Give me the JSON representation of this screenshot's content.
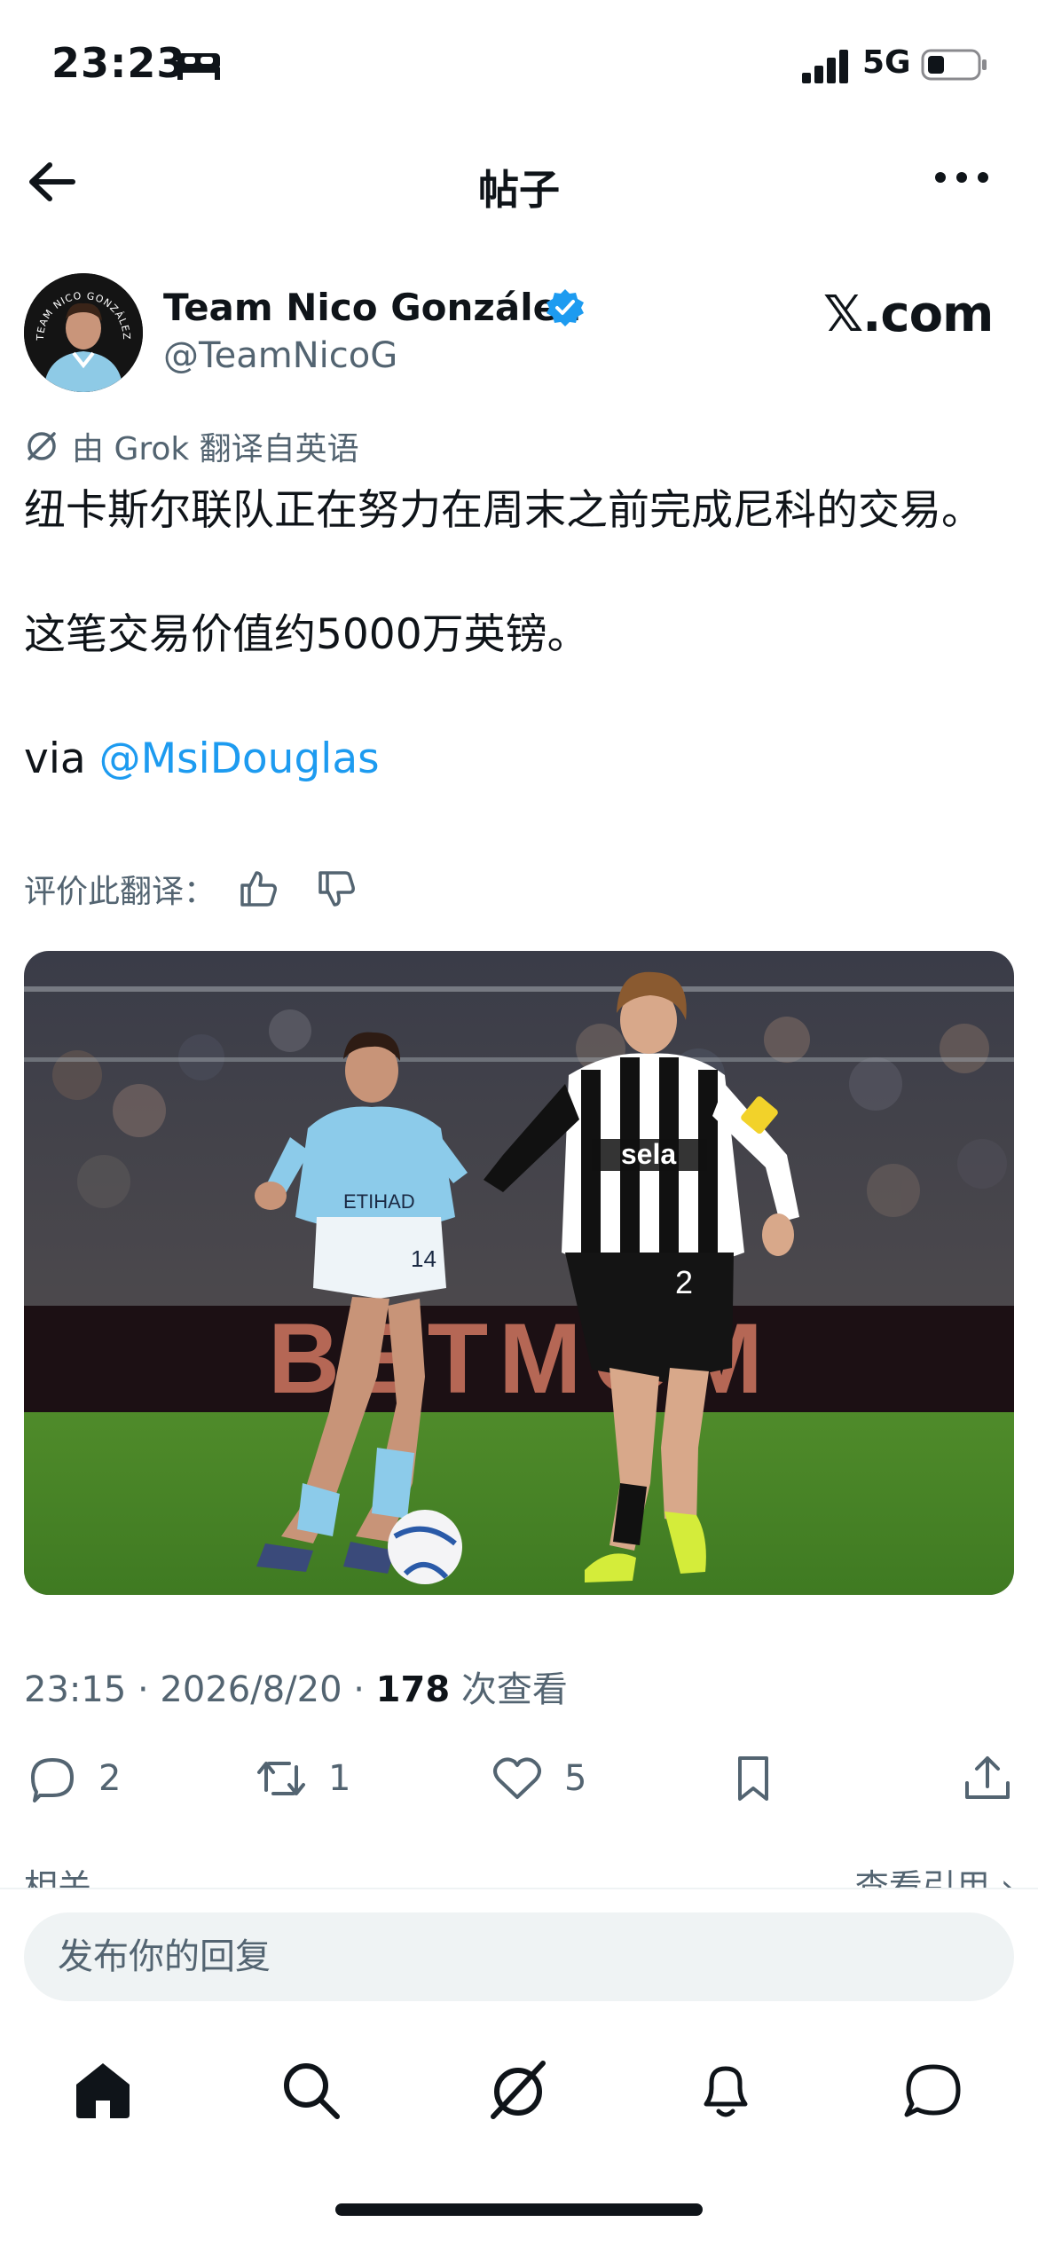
{
  "status_bar": {
    "time": "23:23",
    "network": "5G",
    "icons": [
      "bed-icon",
      "signal-icon",
      "battery-icon"
    ]
  },
  "header": {
    "title": "帖子",
    "icons": [
      "back-arrow-icon",
      "more-icon"
    ]
  },
  "post": {
    "author_name": "Team Nico González",
    "author_handle": "@TeamNicoG",
    "avatar_caption": "TEAM NICO GONZÁLEZ",
    "source_logo": "𝕏.com",
    "translation_label": "由 Grok 翻译自英语",
    "paragraph_1": "纽卡斯尔联队正在努力在周末之前完成尼科的交易。",
    "paragraph_2": "这笔交易价值约5000万英镑。",
    "via_prefix": "via ",
    "mention": "@MsiDouglas",
    "rate_label": "评价此翻译：",
    "timestamp": "23:15 · 2026/8/20 · ",
    "views_count": "178",
    "views_label": " 次查看",
    "photo_texts": {
      "shirt_left_number": "14",
      "shirt_right_sponsor": "sela",
      "shirt_right_number": "2",
      "board_text": "BETMGM"
    }
  },
  "actions": {
    "replies": "2",
    "reposts": "1",
    "likes": "5"
  },
  "related": {
    "left_label": "相关 ⌄",
    "right_label": "查看引用 ›"
  },
  "reply": {
    "placeholder": "发布你的回复"
  },
  "bottom_nav": [
    "home-icon",
    "search-icon",
    "grok-icon",
    "notifications-icon",
    "messages-icon"
  ],
  "colors": {
    "accent": "#1d9bf0",
    "text_primary": "#0f1419",
    "text_secondary": "#536471"
  }
}
